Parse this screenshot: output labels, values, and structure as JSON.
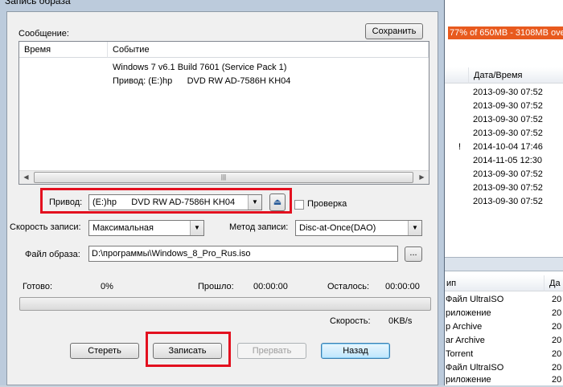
{
  "dialog": {
    "title": "Запись образа",
    "message_label": "Сообщение:",
    "save_button": "Сохранить",
    "log": {
      "columns": [
        "Время",
        "Событие"
      ],
      "lines": [
        "Windows 7 v6.1 Build 7601 (Service Pack 1)",
        "Привод: (E:)hp      DVD RW AD-7586H KH04"
      ]
    },
    "drive": {
      "label": "Привод:",
      "value": "(E:)hp      DVD RW AD-7586H KH04",
      "verify_label": "Проверка",
      "verify_checked": false
    },
    "speed": {
      "label": "Скорость записи:",
      "value": "Максимальная"
    },
    "method": {
      "label": "Метод записи:",
      "value": "Disc-at-Once(DAO)"
    },
    "image_file": {
      "label": "Файл образа:",
      "value": "D:\\программы\\Windows_8_Pro_Rus.iso",
      "browse": "..."
    },
    "progress": {
      "ready_label": "Готово:",
      "ready_value": "0%",
      "elapsed_label": "Прошло:",
      "elapsed_value": "00:00:00",
      "remaining_label": "Осталось:",
      "remaining_value": "00:00:00",
      "speed_label": "Скорость:",
      "speed_value": "0KB/s",
      "fraction": 0
    },
    "buttons": {
      "erase": "Стереть",
      "write": "Записать",
      "abort": "Прервать",
      "back": "Назад"
    }
  },
  "background": {
    "capacity_text": "77% of 650MB - 3108MB ove",
    "date_header": "Дата/Время",
    "dates": [
      "2013-09-30 07:52",
      "2013-09-30 07:52",
      "2013-09-30 07:52",
      "2013-09-30 07:52",
      "2014-10-04 17:46",
      "2014-11-05 12:30",
      "2013-09-30 07:52",
      "2013-09-30 07:52",
      "2013-09-30 07:52"
    ],
    "marker": "!",
    "type_header": "ип",
    "date_header2": "Да",
    "files": [
      {
        "type": "Файл UltraISO",
        "date": "20"
      },
      {
        "type": "риложение",
        "date": "20"
      },
      {
        "type": "p Archive",
        "date": "20"
      },
      {
        "type": "ar Archive",
        "date": "20"
      },
      {
        "type": "Torrent",
        "date": "20"
      },
      {
        "type": "Файл UltraISO",
        "date": "20"
      },
      {
        "type": "риложение",
        "date": "20"
      }
    ]
  },
  "colors": {
    "highlight": "#e3101f",
    "capacity_bar": "#e85a1e"
  }
}
